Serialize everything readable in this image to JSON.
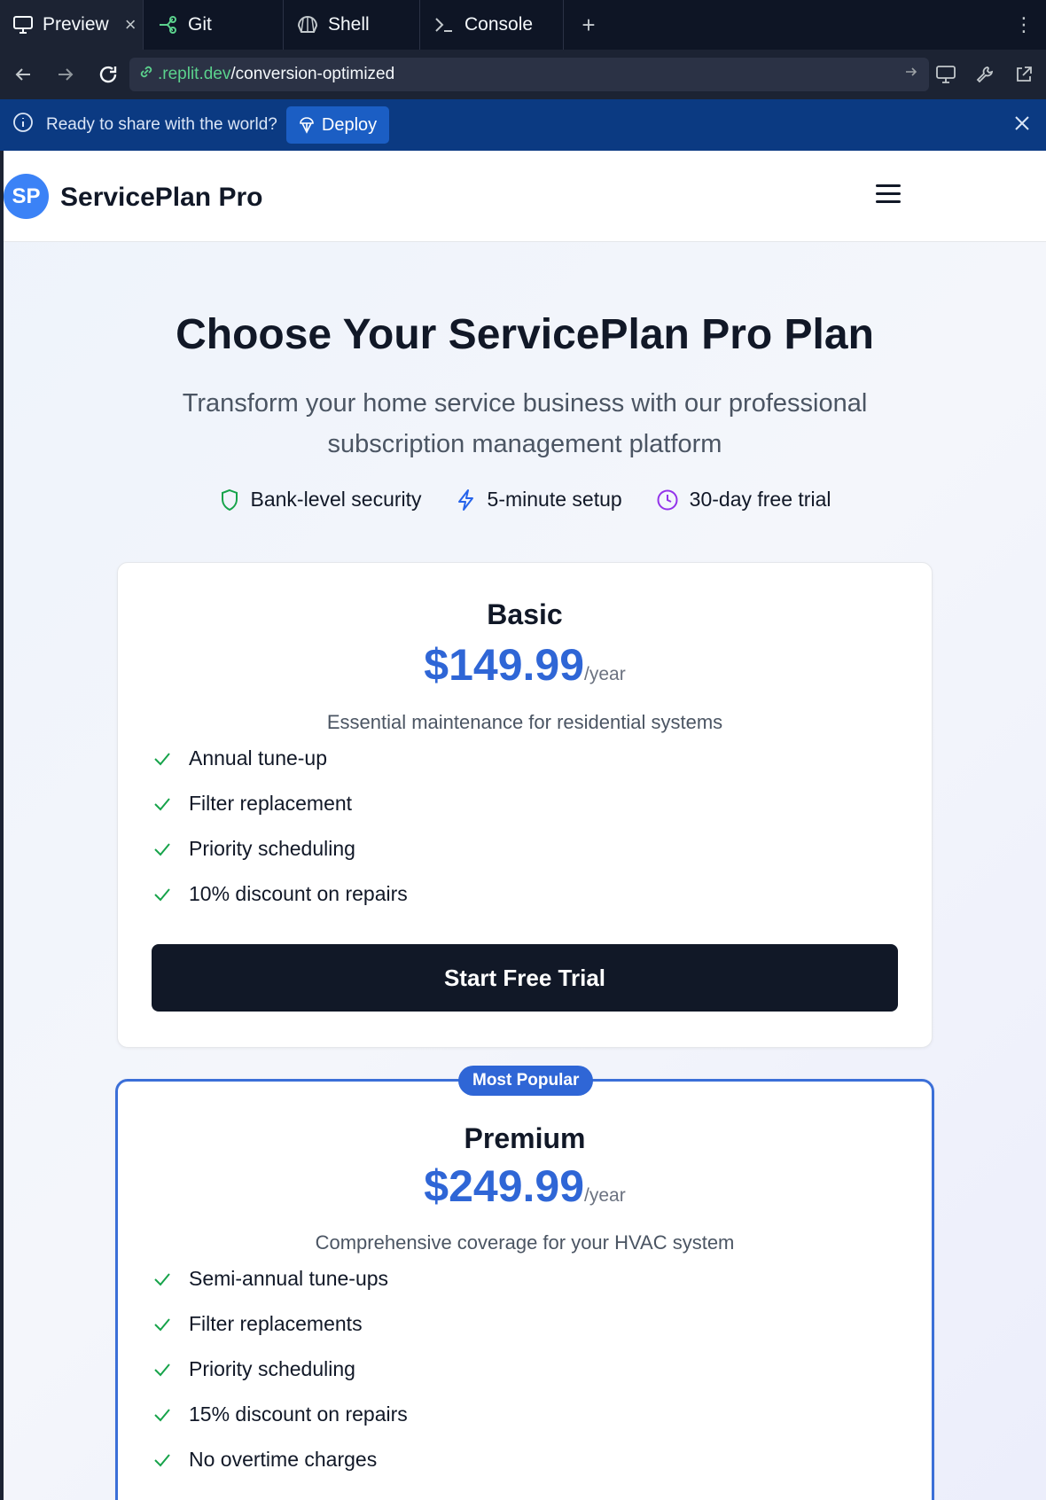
{
  "tabs": [
    {
      "label": "Preview",
      "icon": "monitor-icon",
      "active": true
    },
    {
      "label": "Git",
      "icon": "git-branch-icon"
    },
    {
      "label": "Shell",
      "icon": "shell-icon"
    },
    {
      "label": "Console",
      "icon": "terminal-prompt-icon"
    }
  ],
  "url": {
    "domain": ".replit.dev",
    "path": "/conversion-optimized"
  },
  "banner": {
    "message": "Ready to share with the world?",
    "button": "Deploy"
  },
  "site": {
    "avatar": "SP",
    "brand": "ServicePlan Pro"
  },
  "hero": {
    "title": "Choose Your ServicePlan Pro Plan",
    "subtitle": "Transform your home service business with our professional subscription management platform",
    "badges": [
      {
        "label": "Bank-level security",
        "icon": "shield-icon",
        "color": "#16a34a"
      },
      {
        "label": "5-minute setup",
        "icon": "lightning-icon",
        "color": "#2563eb"
      },
      {
        "label": "30-day free trial",
        "icon": "clock-icon",
        "color": "#9333ea"
      }
    ]
  },
  "plans": {
    "basic": {
      "name": "Basic",
      "price": "$149.99",
      "period": "/year",
      "description": "Essential maintenance for residential systems",
      "features": [
        "Annual tune-up",
        "Filter replacement",
        "Priority scheduling",
        "10% discount on repairs"
      ],
      "cta": "Start Free Trial"
    },
    "premium": {
      "badge": "Most Popular",
      "name": "Premium",
      "price": "$249.99",
      "period": "/year",
      "description": "Comprehensive coverage for your HVAC system",
      "features": [
        "Semi-annual tune-ups",
        "Filter replacements",
        "Priority scheduling",
        "15% discount on repairs",
        "No overtime charges"
      ]
    }
  },
  "colors": {
    "accent": "#2f66d6",
    "check": "#16a34a",
    "banner": "#0b3a82"
  }
}
